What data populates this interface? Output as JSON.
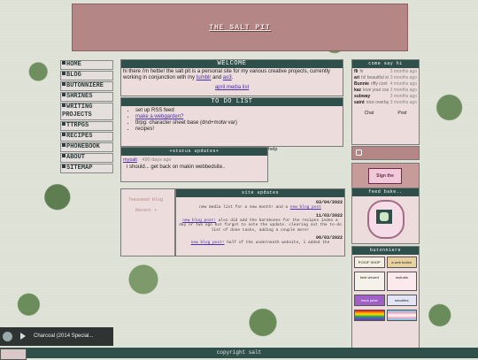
{
  "site": {
    "title": "THE SALT PIT"
  },
  "nav": [
    "HOME",
    "BLOG",
    "BUTONNIERE",
    "SHRINES",
    "WRITING PROJECTS",
    "TTRPGS",
    "RECIPES",
    "PHONEBOOK",
    "ABOUT",
    "SITEMAP"
  ],
  "welcome": {
    "title": "WELCOME",
    "text1": "hi there i'm hettie! the salt pit is a personal site for my various creative projects, currently working in conjunction with my",
    "link1": "tumblr",
    "and": "and",
    "link2": "ao3",
    "period": ".",
    "link3": "april.media list"
  },
  "todo": {
    "title": "TO DO LIST",
    "items": [
      "set up RSS feed",
      "make a webgarden?",
      "ttrpg: character sheet base (dnd+motw var)",
      "recipes!"
    ]
  },
  "status": {
    "title": "+status updates+",
    "user": "mysalt",
    "ago": "490 days ago",
    "message": "i should... get back on makin webbedsite..",
    "help": "help"
  },
  "blog": {
    "title": "Teesoeed Blog",
    "subtitle": "Recent +"
  },
  "updates": {
    "title": "site updates",
    "entries": [
      {
        "date": "03/04/2022",
        "text": "new media list for a new month! and a",
        "link": "new blog post"
      },
      {
        "date": "11/03/2022",
        "link": "new blog post!",
        "text": "also did add the barebones for the recipes index a day or two ago but forgot to note the update. clearing out the to-do list of done tasks, adding a couple more!"
      },
      {
        "date": "06/03/2022",
        "link": "new blog post!",
        "text": "half of the underneath website, i added the"
      }
    ]
  },
  "chat": {
    "title": "come say hi",
    "entries": [
      {
        "name": "fli",
        "text": "hi",
        "ago": "3 months ago"
      },
      {
        "name": "ari",
        "text": "hi! beautiful site",
        "ago": "3 months ago"
      },
      {
        "name": "Bunnie",
        "text": "riffy cool site",
        "ago": "4 months ago"
      },
      {
        "name": "kaz",
        "text": "love your css!",
        "ago": "3 months ago"
      },
      {
        "name": "subway",
        "text": "",
        "ago": "3 months ago"
      },
      {
        "name": "saint",
        "text": "nice overlay effect!",
        "ago": "3 months ago"
      }
    ],
    "controls": [
      "Chat",
      "Post"
    ]
  },
  "sign": {
    "label": "Sign the guestbook"
  },
  "feed": {
    "title": "feed bake.."
  },
  "buttonniere": {
    "title": "butonniere",
    "badges": [
      "POGIF SHOP",
      "a web button",
      "trans pride",
      "best viewed",
      "mutuals",
      "neocities"
    ]
  },
  "media": {
    "track": "Charcoal (2014 Special..."
  },
  "footer": {
    "text": "copyright salt"
  }
}
